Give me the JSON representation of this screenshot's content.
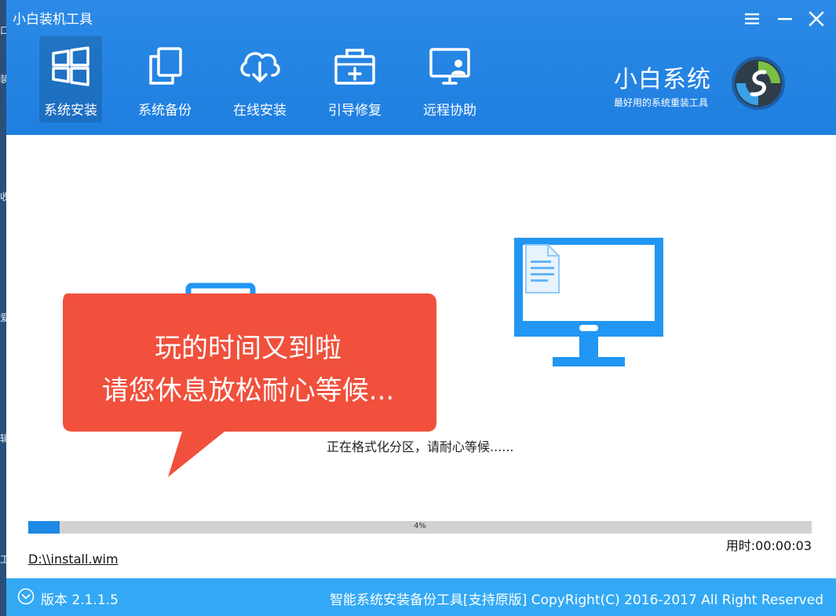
{
  "desktop_edge": {
    "chars": [
      "口",
      "装",
      "收",
      "爱",
      "辑",
      "工"
    ]
  },
  "app": {
    "title": "小白装机工具"
  },
  "window_controls": {
    "menu": "≡",
    "minimize": "—",
    "close": "✕"
  },
  "nav": {
    "items": [
      {
        "label": "系统安装",
        "icon": "windows-icon",
        "active": true
      },
      {
        "label": "系统备份",
        "icon": "copy-icon"
      },
      {
        "label": "在线安装",
        "icon": "cloud-download-icon"
      },
      {
        "label": "引导修复",
        "icon": "toolbox-icon"
      },
      {
        "label": "远程协助",
        "icon": "remote-support-icon"
      }
    ]
  },
  "brand": {
    "name": "小白系统",
    "slogan": "最好用的系统重装工具"
  },
  "bubble": {
    "line1": "玩的时间又到啦",
    "line2": "请您休息放松耐心等候..."
  },
  "status": {
    "message": "正在格式化分区，请耐心等候......"
  },
  "progress": {
    "value": 0.04,
    "label": "4%"
  },
  "elapsed": {
    "label": "用时:",
    "value": "00:00:03"
  },
  "file": {
    "path": "D:\\\\install.wim"
  },
  "footer": {
    "version": "版本 2.1.1.5",
    "copyright": "智能系统安装备份工具[支持原版]  CopyRight(C) 2016-2017 All Right Reserved"
  },
  "colors": {
    "header": "#1f7fe0",
    "accent": "#1e88e5",
    "bubble": "#f0503c",
    "footer": "#33a9f5",
    "progress_track": "#d2d2d2"
  }
}
